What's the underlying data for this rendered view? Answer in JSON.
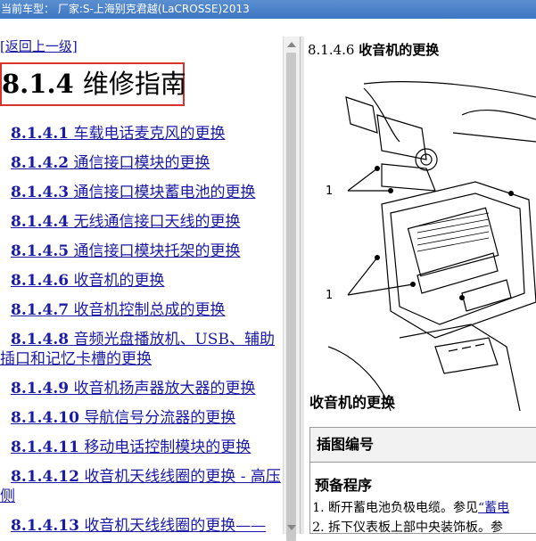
{
  "window": {
    "title": "当前车型： 厂家:S-上海别克君越(LaCROSSE)2013"
  },
  "nav": {
    "back_label": "[返回上一级]"
  },
  "heading": {
    "number": "8.1.4",
    "text": "维修指南"
  },
  "toc": [
    {
      "number": "8.1.4.1",
      "text": "车载电话麦克风的更换"
    },
    {
      "number": "8.1.4.2",
      "text": "通信接口模块的更换"
    },
    {
      "number": "8.1.4.3",
      "text": "通信接口模块蓄电池的更换"
    },
    {
      "number": "8.1.4.4",
      "text": "无线通信接口天线的更换"
    },
    {
      "number": "8.1.4.5",
      "text": "通信接口模块托架的更换"
    },
    {
      "number": "8.1.4.6",
      "text": "收音机的更换"
    },
    {
      "number": "8.1.4.7",
      "text": "收音机控制总成的更换"
    },
    {
      "number": "8.1.4.8",
      "text": "音频光盘播放机、USB、辅助插口和记忆卡槽的更换"
    },
    {
      "number": "8.1.4.9",
      "text": "收音机扬声器放大器的更换"
    },
    {
      "number": "8.1.4.10",
      "text": "导航信号分流器的更换"
    },
    {
      "number": "8.1.4.11",
      "text": "移动电话控制模块的更换"
    },
    {
      "number": "8.1.4.12",
      "text": "收音机天线线圈的更换 - 高压侧"
    },
    {
      "number": "8.1.4.13",
      "text": "收音机天线线圈的更换——"
    }
  ],
  "detail": {
    "number": "8.1.4.6",
    "title": "收音机的更换",
    "callout_label": "1",
    "section_title": "收音机的更换",
    "table_header": "插图编号",
    "procedure_title": "预备程序",
    "steps": [
      {
        "text": "断开蓄电池负极电缆。参见",
        "link": "“蓄电"
      },
      {
        "text": "拆下仪表板上部中央装饰板。参",
        "link": ""
      }
    ]
  }
}
